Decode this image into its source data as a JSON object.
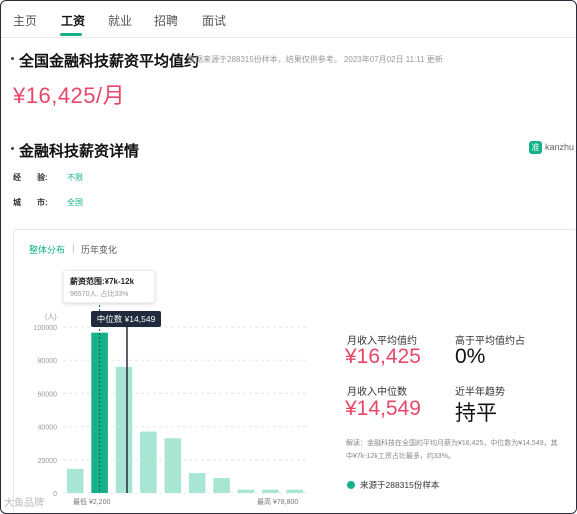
{
  "nav": {
    "tabs": [
      "主页",
      "工资",
      "就业",
      "招聘",
      "面试"
    ],
    "active_tab": "工资"
  },
  "summary": {
    "title": "全国金融科技薪资平均值约",
    "meta": "数据来源于288315份样本，结果仅供参考。 2023年07月02日 11:11 更新",
    "salary": "¥16,425/月"
  },
  "detail": {
    "title": "金融科技薪资详情",
    "logo_text": "kanzhu",
    "logo_badge": "准",
    "experience_label": "经　　验:",
    "experience_value": "不限",
    "city_label": "城　　市:",
    "city_value": "全国"
  },
  "chart_tabs": [
    "整体分布",
    "历年变化"
  ],
  "tooltip": {
    "range": "薪资范围:¥7k-12k",
    "detail": "96570人, 占比33%"
  },
  "median_tag": "中位数 ¥14,549",
  "chart_data": {
    "type": "bar",
    "y_unit": "(人)",
    "ylim": [
      0,
      100000
    ],
    "y_ticks": [
      "100000",
      "80000",
      "60000",
      "40000",
      "20000",
      "0"
    ],
    "values": [
      14500,
      96570,
      76000,
      37000,
      33000,
      12000,
      9000,
      2000,
      2000,
      2000
    ],
    "highlight_index": 1,
    "x_min_label": "最低 ¥2,200",
    "x_max_label": "最高 ¥78,800",
    "highlight_color": "#16b08a",
    "bar_color": "#a8e6d3"
  },
  "stats": {
    "avg_label": "月收入平均值约",
    "avg_value": "¥16,425",
    "above_avg_label": "高于平均值约占",
    "above_avg_value": "0%",
    "median_label": "月收入中位数",
    "median_value": "¥14,549",
    "trend_label": "近半年趋势",
    "trend_value": "持平"
  },
  "note": "解读：金融科技在全国的平均月薪为¥16,425，中位数为¥14,549，其中¥7k-12k工资占比最多，约33%。",
  "source": "来源于288315份样本",
  "watermark": "大鱼品牌"
}
